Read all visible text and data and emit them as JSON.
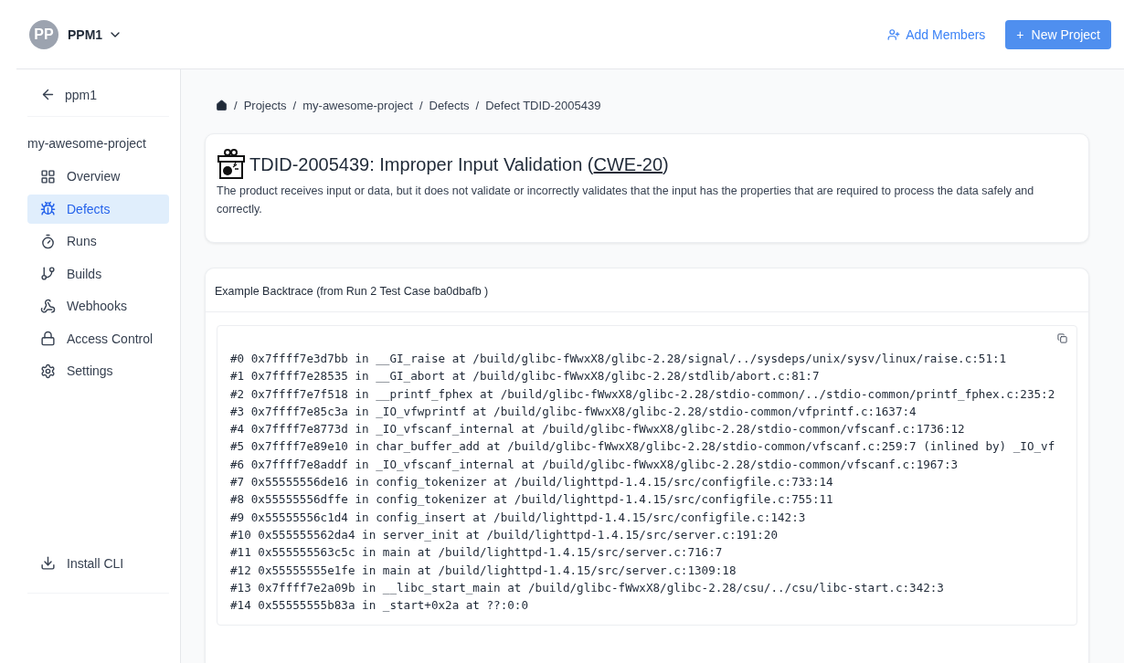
{
  "header": {
    "avatar": "PP",
    "org": "PPM1",
    "add_members": "Add Members",
    "new_project": "New Project",
    "new_project_icon": "+"
  },
  "sidebar": {
    "back": "ppm1",
    "project": "my-awesome-project",
    "items": [
      {
        "label": "Overview",
        "selected": false
      },
      {
        "label": "Defects",
        "selected": true
      },
      {
        "label": "Runs",
        "selected": false
      },
      {
        "label": "Builds",
        "selected": false
      },
      {
        "label": "Webhooks",
        "selected": false
      },
      {
        "label": "Access Control",
        "selected": false
      },
      {
        "label": "Settings",
        "selected": false
      }
    ],
    "footer": {
      "label": "Install CLI"
    }
  },
  "breadcrumb": [
    {
      "separator": "/",
      "label": "Projects"
    },
    {
      "separator": "/",
      "label": "my-awesome-project"
    },
    {
      "separator": "/",
      "label": "Defects"
    },
    {
      "separator": "/",
      "label": "Defect TDID-2005439"
    }
  ],
  "defect": {
    "title": "TDID-2005439: Improper Input Validation (",
    "cwe": "CWE-20",
    "title_end": ")",
    "description": "The product receives input or data, but it does not validate or incorrectly validates that the input has the properties that are required to process the data safely and correctly."
  },
  "backtrace": {
    "title": "Example Backtrace (from Run 2 Test Case  ba0dbafb  )",
    "lines": [
      "#0 0x7ffff7e3d7bb in __GI_raise at /build/glibc-fWwxX8/glibc-2.28/signal/../sysdeps/unix/sysv/linux/raise.c:51:1",
      "#1 0x7ffff7e28535 in __GI_abort at /build/glibc-fWwxX8/glibc-2.28/stdlib/abort.c:81:7",
      "#2 0x7ffff7e7f518 in __printf_fphex at /build/glibc-fWwxX8/glibc-2.28/stdio-common/../stdio-common/printf_fphex.c:235:2",
      "#3 0x7ffff7e85c3a in _IO_vfwprintf at /build/glibc-fWwxX8/glibc-2.28/stdio-common/vfprintf.c:1637:4",
      "#4 0x7ffff7e8773d in _IO_vfscanf_internal at /build/glibc-fWwxX8/glibc-2.28/stdio-common/vfscanf.c:1736:12",
      "#5 0x7ffff7e89e10 in char_buffer_add at /build/glibc-fWwxX8/glibc-2.28/stdio-common/vfscanf.c:259:7 (inlined by) _IO_vf",
      "#6 0x7ffff7e8addf in _IO_vfscanf_internal at /build/glibc-fWwxX8/glibc-2.28/stdio-common/vfscanf.c:1967:3",
      "#7 0x55555556de16 in config_tokenizer at /build/lighttpd-1.4.15/src/configfile.c:733:14",
      "#8 0x55555556dffe in config_tokenizer at /build/lighttpd-1.4.15/src/configfile.c:755:11",
      "#9 0x55555556c1d4 in config_insert at /build/lighttpd-1.4.15/src/configfile.c:142:3",
      "#10 0x555555562da4 in server_init at /build/lighttpd-1.4.15/src/server.c:191:20",
      "#11 0x555555563c5c in main at /build/lighttpd-1.4.15/src/server.c:716:7",
      "#12 0x55555555e1fe in main at /build/lighttpd-1.4.15/src/server.c:1309:18",
      "#13 0x7ffff7e2a09b in __libc_start_main at /build/glibc-fWwxX8/glibc-2.28/csu/../csu/libc-start.c:342:3",
      "#14 0x55555555b83a in _start+0x2a at ??:0:0"
    ]
  }
}
